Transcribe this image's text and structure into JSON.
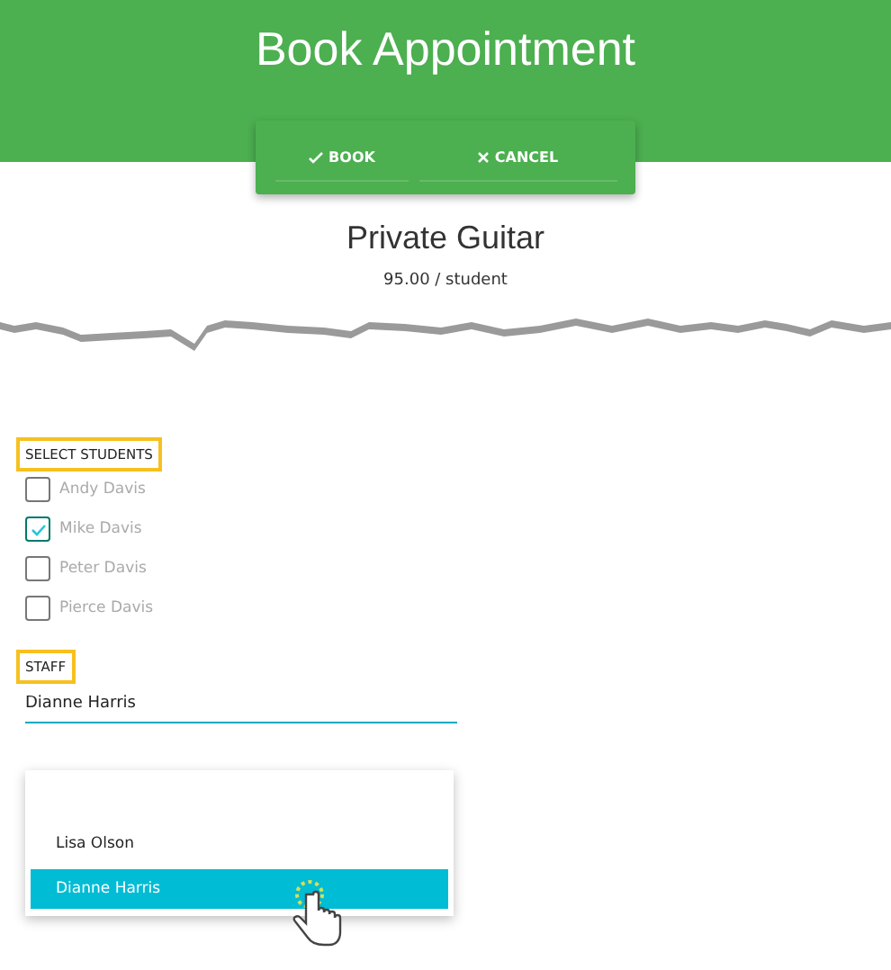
{
  "header": {
    "title": "Book Appointment"
  },
  "actions": [
    {
      "kind": "check",
      "label": "BOOK"
    },
    {
      "kind": "close",
      "label": "CANCEL"
    }
  ],
  "service": {
    "name": "Private Guitar",
    "price": "95.00 / student"
  },
  "students": {
    "label": "SELECT STUDENTS",
    "items": [
      {
        "name": "Andy Davis",
        "checked": false
      },
      {
        "name": "Mike Davis",
        "checked": true
      },
      {
        "name": "Peter Davis",
        "checked": false
      },
      {
        "name": "Pierce Davis",
        "checked": false
      }
    ]
  },
  "staff": {
    "label": "STAFF",
    "value": "Dianne Harris",
    "options": [
      {
        "name": "Lisa Olson",
        "selected": false
      },
      {
        "name": "Dianne Harris",
        "selected": true
      }
    ]
  }
}
